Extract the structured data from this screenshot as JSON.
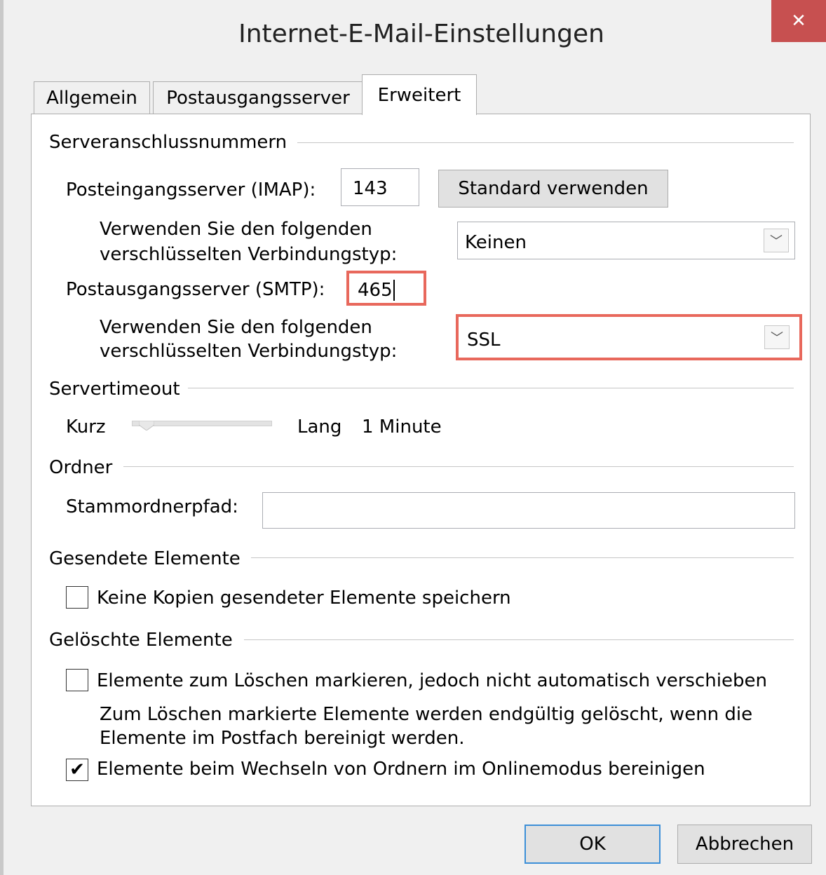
{
  "window": {
    "title": "Internet-E-Mail-Einstellungen",
    "close_glyph": "✕"
  },
  "tabs": [
    {
      "label": "Allgemein"
    },
    {
      "label": "Postausgangsserver"
    },
    {
      "label": "Erweitert"
    }
  ],
  "server_ports": {
    "section_label": "Serveranschlussnummern",
    "imap_label": "Posteingangsserver (IMAP):",
    "imap_value": "143",
    "use_default_label": "Standard verwenden",
    "imap_encryption_label_line1": "Verwenden Sie den folgenden",
    "imap_encryption_label_line2": "verschlüsselten Verbindungstyp:",
    "imap_encryption_value": "Keinen",
    "smtp_label": "Postausgangsserver (SMTP):",
    "smtp_value": "465",
    "smtp_encryption_label_line1": "Verwenden Sie den folgenden",
    "smtp_encryption_label_line2": "verschlüsselten Verbindungstyp:",
    "smtp_encryption_value": "SSL"
  },
  "timeout": {
    "section_label": "Servertimeout",
    "short_label": "Kurz",
    "long_label": "Lang",
    "value_text": "1 Minute",
    "slider_level": 0.1
  },
  "folders": {
    "section_label": "Ordner",
    "root_path_label": "Stammordnerpfad:",
    "root_path_value": ""
  },
  "sent_items": {
    "section_label": "Gesendete Elemente",
    "no_copies_label": "Keine Kopien gesendeter Elemente speichern",
    "no_copies_checked": false
  },
  "deleted_items": {
    "section_label": "Gelöschte Elemente",
    "mark_label": "Elemente zum Löschen markieren, jedoch nicht automatisch verschieben",
    "mark_checked": false,
    "mark_note_line1": "Zum Löschen markierte Elemente werden endgültig gelöscht, wenn die",
    "mark_note_line2": "Elemente im Postfach bereinigt werden.",
    "purge_label": "Elemente beim Wechseln von Ordnern im Onlinemodus bereinigen",
    "purge_checked": true
  },
  "buttons": {
    "ok": "OK",
    "cancel": "Abbrechen"
  },
  "colors": {
    "highlight": "#e8685c",
    "close_button": "#c75050"
  }
}
